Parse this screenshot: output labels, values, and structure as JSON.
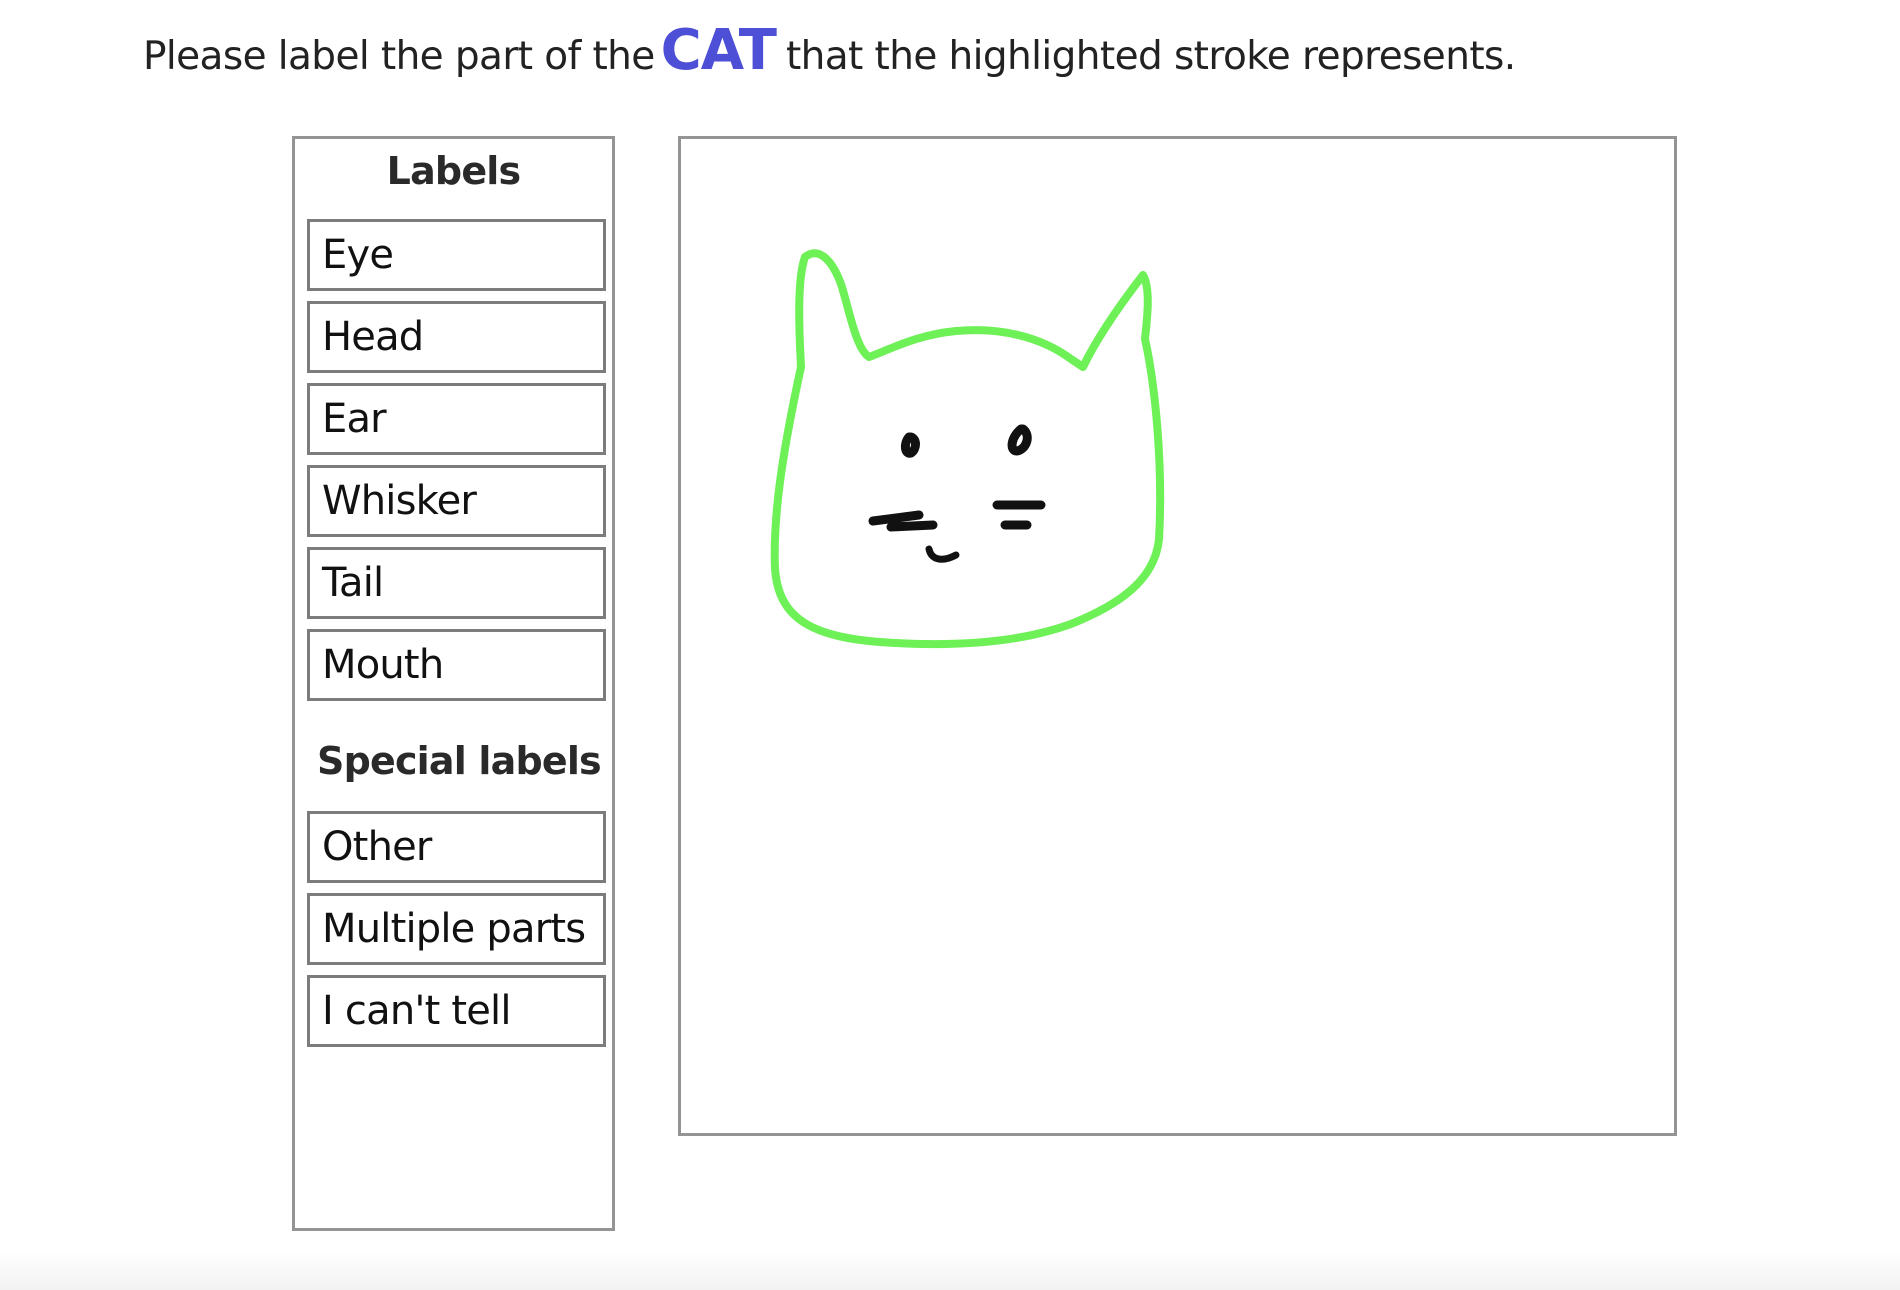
{
  "instruction": {
    "prefix": "Please label the part of the",
    "category": "CAT",
    "suffix": "that the highlighted stroke represents."
  },
  "labels_panel": {
    "title": "Labels",
    "labels": [
      "Eye",
      "Head",
      "Ear",
      "Whisker",
      "Tail",
      "Mouth"
    ],
    "special_title": "Special labels",
    "special_labels": [
      "Other",
      "Multiple parts",
      "I can't tell"
    ]
  },
  "canvas": {
    "highlight_color": "#6ef057",
    "stroke_color": "#111111"
  },
  "colors": {
    "category_text": "#4d4fd6",
    "border": "#949494"
  }
}
